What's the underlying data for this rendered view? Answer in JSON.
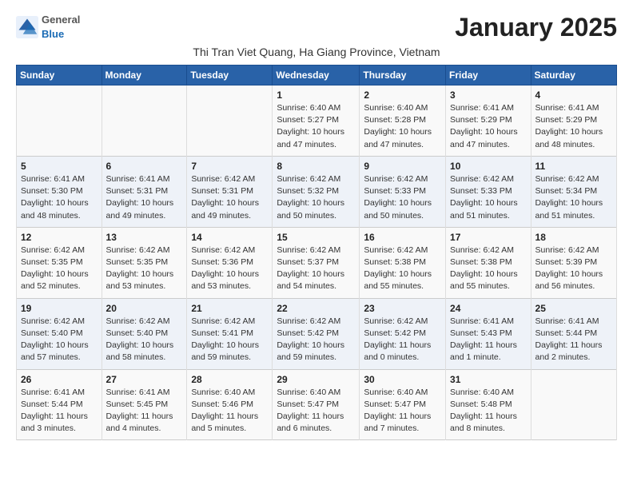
{
  "logo": {
    "general": "General",
    "blue": "Blue"
  },
  "title": "January 2025",
  "subtitle": "Thi Tran Viet Quang, Ha Giang Province, Vietnam",
  "days_of_week": [
    "Sunday",
    "Monday",
    "Tuesday",
    "Wednesday",
    "Thursday",
    "Friday",
    "Saturday"
  ],
  "weeks": [
    [
      {
        "day": "",
        "info": ""
      },
      {
        "day": "",
        "info": ""
      },
      {
        "day": "",
        "info": ""
      },
      {
        "day": "1",
        "info": "Sunrise: 6:40 AM\nSunset: 5:27 PM\nDaylight: 10 hours and 47 minutes."
      },
      {
        "day": "2",
        "info": "Sunrise: 6:40 AM\nSunset: 5:28 PM\nDaylight: 10 hours and 47 minutes."
      },
      {
        "day": "3",
        "info": "Sunrise: 6:41 AM\nSunset: 5:29 PM\nDaylight: 10 hours and 47 minutes."
      },
      {
        "day": "4",
        "info": "Sunrise: 6:41 AM\nSunset: 5:29 PM\nDaylight: 10 hours and 48 minutes."
      }
    ],
    [
      {
        "day": "5",
        "info": "Sunrise: 6:41 AM\nSunset: 5:30 PM\nDaylight: 10 hours and 48 minutes."
      },
      {
        "day": "6",
        "info": "Sunrise: 6:41 AM\nSunset: 5:31 PM\nDaylight: 10 hours and 49 minutes."
      },
      {
        "day": "7",
        "info": "Sunrise: 6:42 AM\nSunset: 5:31 PM\nDaylight: 10 hours and 49 minutes."
      },
      {
        "day": "8",
        "info": "Sunrise: 6:42 AM\nSunset: 5:32 PM\nDaylight: 10 hours and 50 minutes."
      },
      {
        "day": "9",
        "info": "Sunrise: 6:42 AM\nSunset: 5:33 PM\nDaylight: 10 hours and 50 minutes."
      },
      {
        "day": "10",
        "info": "Sunrise: 6:42 AM\nSunset: 5:33 PM\nDaylight: 10 hours and 51 minutes."
      },
      {
        "day": "11",
        "info": "Sunrise: 6:42 AM\nSunset: 5:34 PM\nDaylight: 10 hours and 51 minutes."
      }
    ],
    [
      {
        "day": "12",
        "info": "Sunrise: 6:42 AM\nSunset: 5:35 PM\nDaylight: 10 hours and 52 minutes."
      },
      {
        "day": "13",
        "info": "Sunrise: 6:42 AM\nSunset: 5:35 PM\nDaylight: 10 hours and 53 minutes."
      },
      {
        "day": "14",
        "info": "Sunrise: 6:42 AM\nSunset: 5:36 PM\nDaylight: 10 hours and 53 minutes."
      },
      {
        "day": "15",
        "info": "Sunrise: 6:42 AM\nSunset: 5:37 PM\nDaylight: 10 hours and 54 minutes."
      },
      {
        "day": "16",
        "info": "Sunrise: 6:42 AM\nSunset: 5:38 PM\nDaylight: 10 hours and 55 minutes."
      },
      {
        "day": "17",
        "info": "Sunrise: 6:42 AM\nSunset: 5:38 PM\nDaylight: 10 hours and 55 minutes."
      },
      {
        "day": "18",
        "info": "Sunrise: 6:42 AM\nSunset: 5:39 PM\nDaylight: 10 hours and 56 minutes."
      }
    ],
    [
      {
        "day": "19",
        "info": "Sunrise: 6:42 AM\nSunset: 5:40 PM\nDaylight: 10 hours and 57 minutes."
      },
      {
        "day": "20",
        "info": "Sunrise: 6:42 AM\nSunset: 5:40 PM\nDaylight: 10 hours and 58 minutes."
      },
      {
        "day": "21",
        "info": "Sunrise: 6:42 AM\nSunset: 5:41 PM\nDaylight: 10 hours and 59 minutes."
      },
      {
        "day": "22",
        "info": "Sunrise: 6:42 AM\nSunset: 5:42 PM\nDaylight: 10 hours and 59 minutes."
      },
      {
        "day": "23",
        "info": "Sunrise: 6:42 AM\nSunset: 5:42 PM\nDaylight: 11 hours and 0 minutes."
      },
      {
        "day": "24",
        "info": "Sunrise: 6:41 AM\nSunset: 5:43 PM\nDaylight: 11 hours and 1 minute."
      },
      {
        "day": "25",
        "info": "Sunrise: 6:41 AM\nSunset: 5:44 PM\nDaylight: 11 hours and 2 minutes."
      }
    ],
    [
      {
        "day": "26",
        "info": "Sunrise: 6:41 AM\nSunset: 5:44 PM\nDaylight: 11 hours and 3 minutes."
      },
      {
        "day": "27",
        "info": "Sunrise: 6:41 AM\nSunset: 5:45 PM\nDaylight: 11 hours and 4 minutes."
      },
      {
        "day": "28",
        "info": "Sunrise: 6:40 AM\nSunset: 5:46 PM\nDaylight: 11 hours and 5 minutes."
      },
      {
        "day": "29",
        "info": "Sunrise: 6:40 AM\nSunset: 5:47 PM\nDaylight: 11 hours and 6 minutes."
      },
      {
        "day": "30",
        "info": "Sunrise: 6:40 AM\nSunset: 5:47 PM\nDaylight: 11 hours and 7 minutes."
      },
      {
        "day": "31",
        "info": "Sunrise: 6:40 AM\nSunset: 5:48 PM\nDaylight: 11 hours and 8 minutes."
      },
      {
        "day": "",
        "info": ""
      }
    ]
  ]
}
